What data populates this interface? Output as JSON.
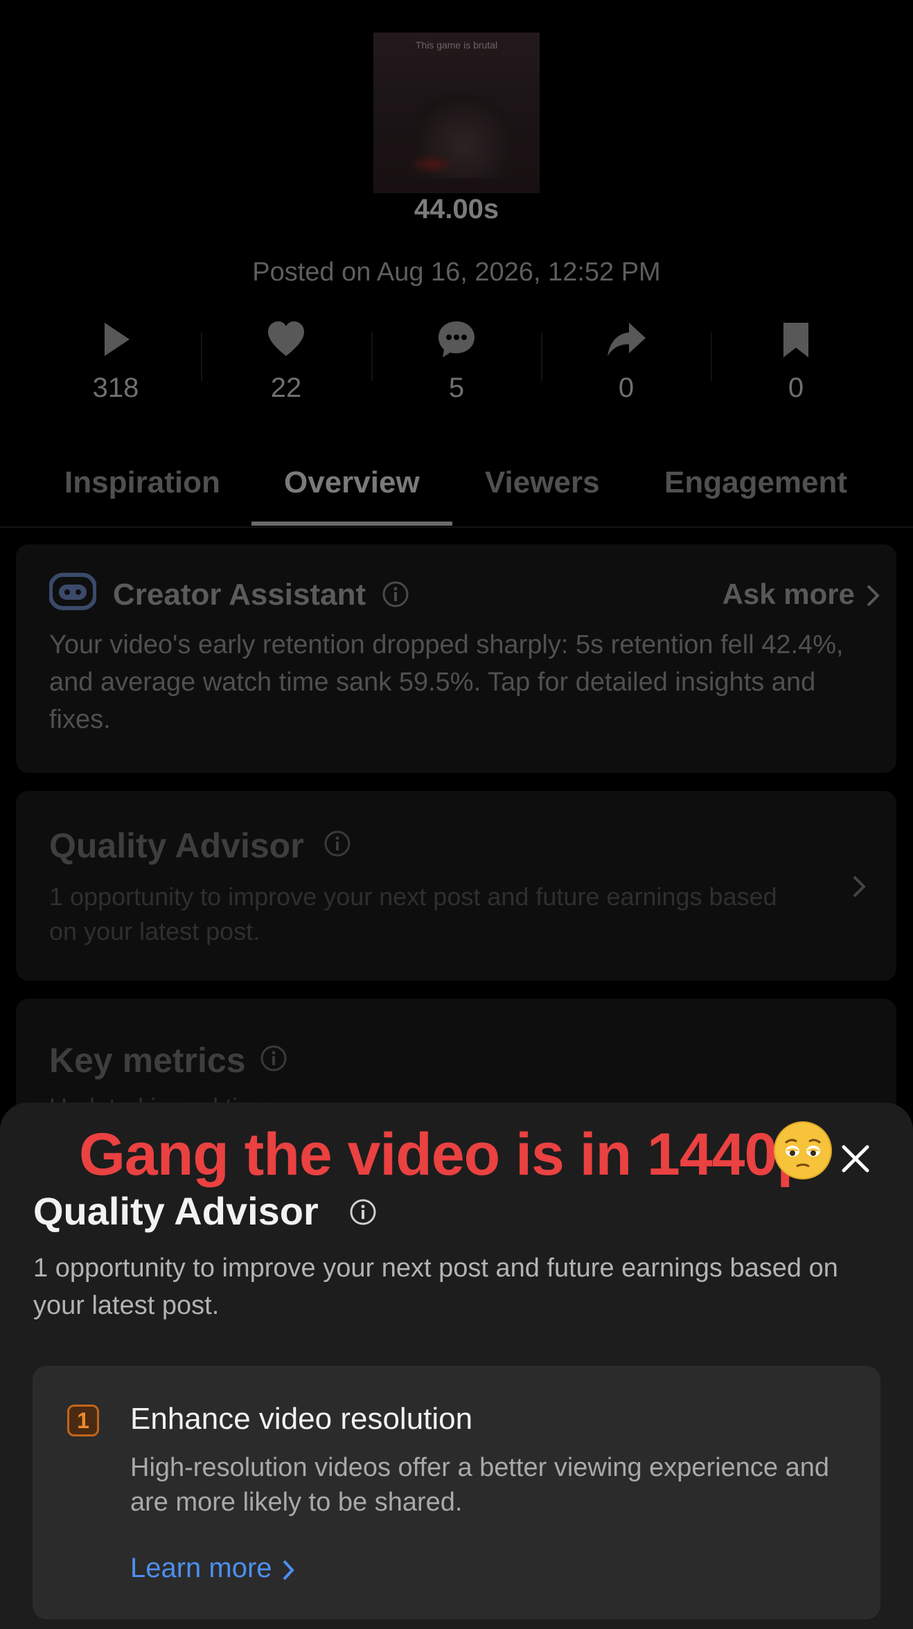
{
  "video": {
    "thumbnail_caption": "This game is brutal",
    "duration": "44.00s",
    "posted": "Posted on Aug 16, 2026, 12:52 PM"
  },
  "stats": {
    "views": "318",
    "likes": "22",
    "comments": "5",
    "shares": "0",
    "saves": "0"
  },
  "tabs": [
    {
      "label": "Inspiration",
      "active": false
    },
    {
      "label": "Overview",
      "active": true
    },
    {
      "label": "Viewers",
      "active": false
    },
    {
      "label": "Engagement",
      "active": false
    }
  ],
  "creator_assistant": {
    "title": "Creator Assistant",
    "ask_more": "Ask more",
    "body": "Your video's early retention dropped sharply: 5s retention fell 42.4%, and average watch time sank 59.5%. Tap for detailed insights and fixes."
  },
  "quality_advisor_card": {
    "title": "Quality Advisor",
    "body": "1 opportunity to improve your next post and future earnings based on your latest post."
  },
  "key_metrics": {
    "title": "Key metrics",
    "subtitle": "Updated in real time"
  },
  "sheet": {
    "overlay_text": "Gang the video is in 1440p",
    "emoji": "pleading-face",
    "title": "Quality Advisor",
    "description": "1 opportunity to improve your next post and future earnings based on your latest post.",
    "opportunity": {
      "number": "1",
      "title": "Enhance video resolution",
      "body": "High-resolution videos offer a better viewing experience and are more likely to be shared.",
      "link": "Learn more"
    }
  },
  "colors": {
    "overlay_red": "#ea4141",
    "link_blue": "#4d8ff0",
    "badge_orange": "#f08a2a",
    "sheet_bg": "#1d1d1d",
    "card_bg": "#2b2b2b"
  }
}
